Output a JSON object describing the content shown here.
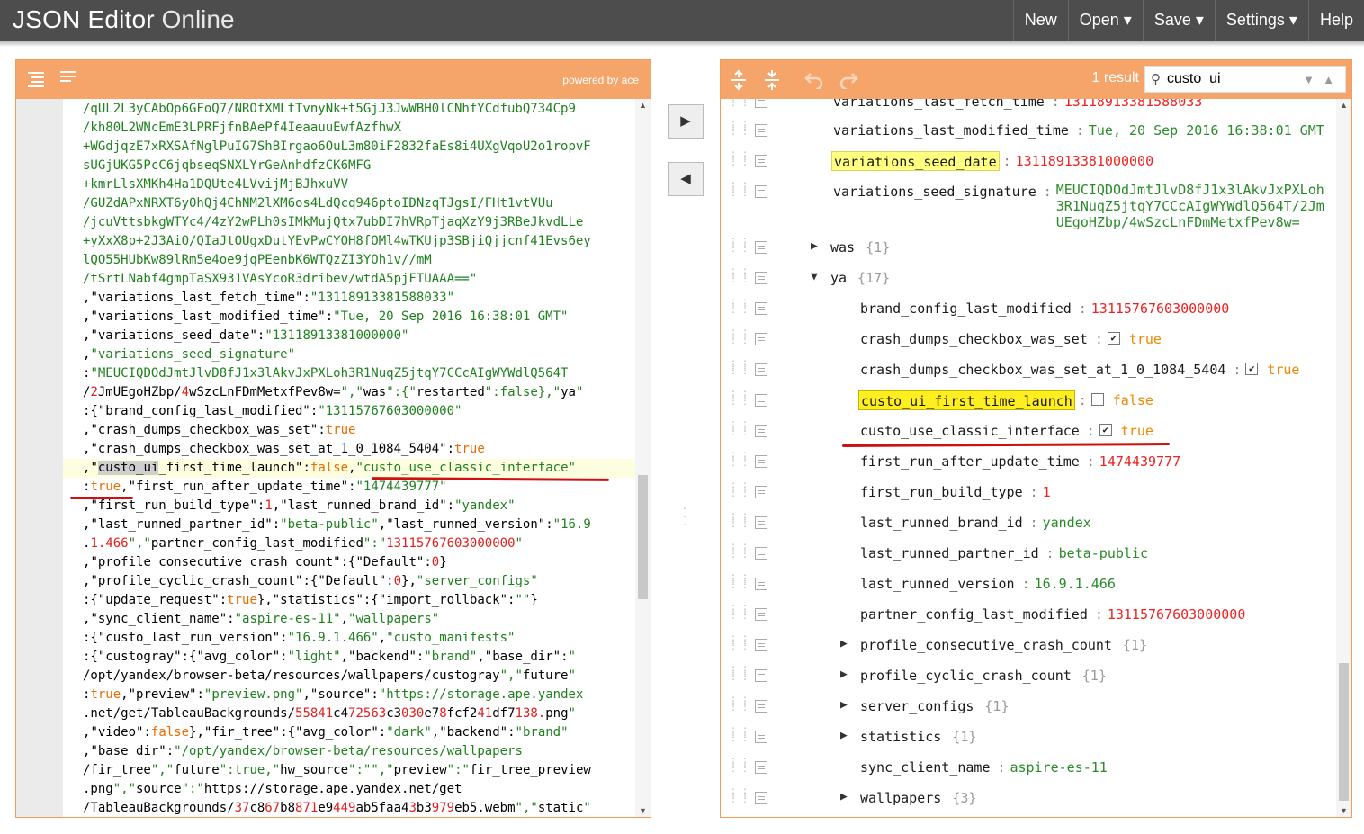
{
  "app": {
    "title_bold": "JSON Editor",
    "title_light": "Online"
  },
  "menu": {
    "new": "New",
    "open": "Open ▾",
    "save": "Save ▾",
    "settings": "Settings ▾",
    "help": "Help"
  },
  "left": {
    "powered_by": "powered by ace",
    "lines": [
      "/qUL2L3yCAbOp6GFoQ7/NROfXMLtTvnyNk+t5GjJ3JwWBH0lCNhfYCdfubQ734Cp9",
      "/kh80L2WNcEmE3LPRFjfnBAePf4IeaauuEwfAzfhwX",
      "+WGdjqzE7xRXSAfNglPuIG7ShBIrgao6OuL3m80iF2832faEs8i4UXgVqoU2o1ropvF",
      "sUGjUKG5PcC6jqbseqSNXLYrGeAnhdfzCK6MFG",
      "+kmrLlsXMKh4Ha1DQUte4LVvijMjBJhxuVV",
      "/GUZdAPxNRXT6y0hQj4ChNM2lXM6os4LdQcq946ptoIDNzqTJgsI/FHt1vtVUu",
      "/jcuVttsbkgWTYc4/4zY2wPLh0sIMkMujQtx7ubDI7hVRpTjaqXzY9j3RBeJkvdLLe",
      "+yXxX8p+2J3AiO/QIaJtOUgxDutYEvPwCYOH8fOMl4wTKUjp3SBjiQjjcnf41Evs6ey",
      "lQO55HUbKw89lRm5e4oe9jqPEenbK6WTQzZI3YOh1v//mM",
      "/tSrtLNabf4gmpTaSX931VAsYcoR3dribev/wtdA5pjFTUAAA==\"",
      ",\"variations_last_fetch_time\":\"13118913381588033\"",
      ",\"variations_last_modified_time\":\"Tue, 20 Sep 2016 16:38:01 GMT\"",
      ",\"variations_seed_date\":\"13118913381000000\"",
      ",\"variations_seed_signature\"",
      ":\"MEUCIQDOdJmtJlvD8fJ1x3lAkvJxPXLoh3R1NuqZ5jtqY7CCcAIgWYWdlQ564T",
      "/2JmUEgoHZbp/4wSzcLnFDmMetxfPev8w=\",\"was\":{\"restarted\":false},\"ya\"",
      ":{\"brand_config_last_modified\":\"13115767603000000\"",
      ",\"crash_dumps_checkbox_was_set\":true",
      ",\"crash_dumps_checkbox_was_set_at_1_0_1084_5404\":true",
      ",\"custo_ui_first_time_launch\":false,\"custo_use_classic_interface\"",
      ":true,\"first_run_after_update_time\":\"1474439777\"",
      ",\"first_run_build_type\":1,\"last_runned_brand_id\":\"yandex\"",
      ",\"last_runned_partner_id\":\"beta-public\",\"last_runned_version\":\"16.9",
      ".1.466\",\"partner_config_last_modified\":\"13115767603000000\"",
      ",\"profile_consecutive_crash_count\":{\"Default\":0}",
      ",\"profile_cyclic_crash_count\":{\"Default\":0},\"server_configs\"",
      ":{\"update_request\":true},\"statistics\":{\"import_rollback\":\"\"}",
      ",\"sync_client_name\":\"aspire-es-11\",\"wallpapers\"",
      ":{\"custo_last_run_version\":\"16.9.1.466\",\"custo_manifests\"",
      ":{\"custogray\":{\"avg_color\":\"light\",\"backend\":\"brand\",\"base_dir\":\"",
      "/opt/yandex/browser-beta/resources/wallpapers/custogray\",\"future\"",
      ":true,\"preview\":\"preview.png\",\"source\":\"https://storage.ape.yandex",
      ".net/get/TableauBackgrounds/55841c472563c3030e78fcf241df7138.png\"",
      ",\"video\":false},\"fir_tree\":{\"avg_color\":\"dark\",\"backend\":\"brand\"",
      ",\"base_dir\":\"/opt/yandex/browser-beta/resources/wallpapers",
      "/fir_tree\",\"future\":true,\"hw_source\":\"\",\"preview\":\"fir_tree_preview",
      ".png\",\"source\":\"https://storage.ape.yandex.net/get",
      "/TableauBackgrounds/37c867b8871e9449ab5faa43b3979eb5.webm\",\"static\""
    ]
  },
  "right": {
    "result_count": "1 result",
    "search_value": "custo_ui",
    "rows": [
      {
        "key": "variations_last_fetch_time",
        "value": "13118913381588033",
        "type": "num"
      },
      {
        "key": "variations_last_modified_time",
        "value": "Tue, 20 Sep 2016 16:38:01 GMT",
        "type": "str"
      },
      {
        "key": "variations_seed_date",
        "value": "13118913381000000",
        "type": "num"
      },
      {
        "key": "variations_seed_signature",
        "value": "MEUCIQDOdJmtJlvD8fJ1x3lAkvJxPXLoh\n3R1NuqZ5jtqY7CCcAIgWYWdlQ564T/2Jm\nUEgoHZbp/4wSzcLnFDmMetxfPev8w=",
        "type": "str"
      },
      {
        "key": "was",
        "value": "{1}",
        "type": "obj"
      },
      {
        "key": "ya",
        "value": "{17}",
        "type": "obj"
      },
      {
        "key": "brand_config_last_modified",
        "value": "13115767603000000",
        "type": "num"
      },
      {
        "key": "crash_dumps_checkbox_was_set",
        "value": "true",
        "type": "bool"
      },
      {
        "key": "crash_dumps_checkbox_was_set_at_1_0_1084_5404",
        "value": "true",
        "type": "bool"
      },
      {
        "key": "custo_ui_first_time_launch",
        "value": "false",
        "type": "bool"
      },
      {
        "key": "custo_use_classic_interface",
        "value": "true",
        "type": "bool"
      },
      {
        "key": "first_run_after_update_time",
        "value": "1474439777",
        "type": "num"
      },
      {
        "key": "first_run_build_type",
        "value": "1",
        "type": "num"
      },
      {
        "key": "last_runned_brand_id",
        "value": "yandex",
        "type": "str"
      },
      {
        "key": "last_runned_partner_id",
        "value": "beta-public",
        "type": "str"
      },
      {
        "key": "last_runned_version",
        "value": "16.9.1.466",
        "type": "str"
      },
      {
        "key": "partner_config_last_modified",
        "value": "13115767603000000",
        "type": "num"
      },
      {
        "key": "profile_consecutive_crash_count",
        "value": "{1}",
        "type": "obj"
      },
      {
        "key": "profile_cyclic_crash_count",
        "value": "{1}",
        "type": "obj"
      },
      {
        "key": "server_configs",
        "value": "{1}",
        "type": "obj"
      },
      {
        "key": "statistics",
        "value": "{1}",
        "type": "obj"
      },
      {
        "key": "sync_client_name",
        "value": "aspire-es-11",
        "type": "str"
      },
      {
        "key": "wallpapers",
        "value": "{3}",
        "type": "obj"
      }
    ]
  }
}
